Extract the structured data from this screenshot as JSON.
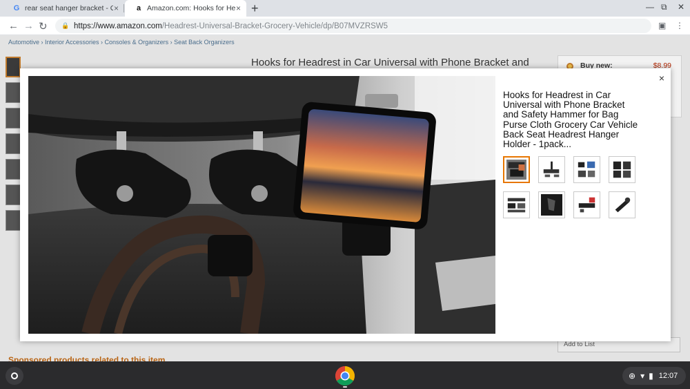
{
  "tabs": [
    {
      "favicon": "G",
      "title": "rear seat hanger bracket - Google",
      "close": "×"
    },
    {
      "favicon": "a",
      "title": "Amazon.com: Hooks for Headrest",
      "close": "×"
    }
  ],
  "new_tab_symbol": "+",
  "window_controls": {
    "minimize": "—",
    "maximize": "⧉",
    "close": "✕"
  },
  "address_bar": {
    "host": "https://www.amazon.com",
    "path": "/Headrest-Universal-Bracket-Grocery-Vehicle/dp/B07MVZRSW5"
  },
  "page": {
    "breadcrumb": "Automotive › Interior Accessories › Consoles & Organizers › Seat Back Organizers",
    "title_partial": "Hooks for Headrest in Car Universal with Phone Bracket and",
    "buy_new_label": "Buy new:",
    "price": "$8.99",
    "add_to_list": "Add to List",
    "sponsored": "Sponsored products related to this item"
  },
  "modal": {
    "close_label": "×",
    "title": "Hooks for Headrest in Car Universal with Phone Bracket and Safety Hammer for Bag Purse Cloth Grocery Car Vehicle Back Seat Headrest Hanger Holder - 1pack...",
    "thumbnails": [
      "thumb-1",
      "thumb-2",
      "thumb-3",
      "thumb-4",
      "thumb-5",
      "thumb-6",
      "thumb-7",
      "thumb-8"
    ],
    "selected_thumbnail": 0
  },
  "shelf": {
    "time": "12:07",
    "accent": "#e77600"
  }
}
